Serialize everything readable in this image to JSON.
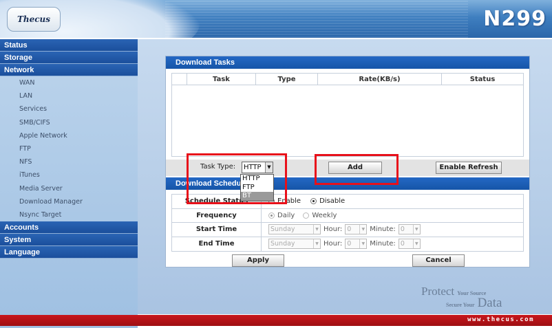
{
  "header": {
    "logo_text": "Thecus",
    "model": "N299"
  },
  "sidebar": {
    "sections": [
      {
        "label": "Status"
      },
      {
        "label": "Storage"
      },
      {
        "label": "Network"
      }
    ],
    "network_items": [
      {
        "label": "WAN"
      },
      {
        "label": "LAN"
      },
      {
        "label": "Services"
      },
      {
        "label": "SMB/CIFS"
      },
      {
        "label": "Apple Network"
      },
      {
        "label": "FTP"
      },
      {
        "label": "NFS"
      },
      {
        "label": "iTunes"
      },
      {
        "label": "Media Server"
      },
      {
        "label": "Download Manager"
      },
      {
        "label": "Nsync Target"
      }
    ],
    "bottom_sections": [
      {
        "label": "Accounts"
      },
      {
        "label": "System"
      },
      {
        "label": "Language"
      }
    ]
  },
  "download_tasks": {
    "title": "Download Tasks",
    "columns": [
      "Task",
      "Type",
      "Rate(KB/s)",
      "Status"
    ]
  },
  "toolbar": {
    "task_type_label": "Task Type:",
    "task_type_value": "HTTP",
    "task_type_options": [
      "HTTP",
      "FTP",
      "BT"
    ],
    "add_label": "Add",
    "enable_refresh_label": "Enable Refresh"
  },
  "schedule": {
    "title": "Download Schedule",
    "rows": {
      "status": {
        "label": "Schedule Status",
        "enable": "Enable",
        "disable": "Disable",
        "selected": "Disable"
      },
      "frequency": {
        "label": "Frequency",
        "daily": "Daily",
        "weekly": "Weekly",
        "selected": "Daily"
      },
      "start": {
        "label": "Start Time",
        "day": "Sunday",
        "hour_label": "Hour:",
        "hour": "0",
        "minute_label": "Minute:",
        "minute": "0"
      },
      "end": {
        "label": "End Time",
        "day": "Sunday",
        "hour_label": "Hour:",
        "hour": "0",
        "minute_label": "Minute:",
        "minute": "0"
      }
    }
  },
  "buttons": {
    "apply": "Apply",
    "cancel": "Cancel"
  },
  "footer": {
    "tagline_1": "Protect",
    "tagline_2": "Your Source",
    "tagline_3": "Secure Your",
    "tagline_4": "Data",
    "url": "www.thecus.com"
  },
  "colors": {
    "header_blue": "#2a66aa",
    "section_blue": "#1b4f9c",
    "highlight_red": "#e8101a",
    "footer_red": "#c8161c"
  }
}
